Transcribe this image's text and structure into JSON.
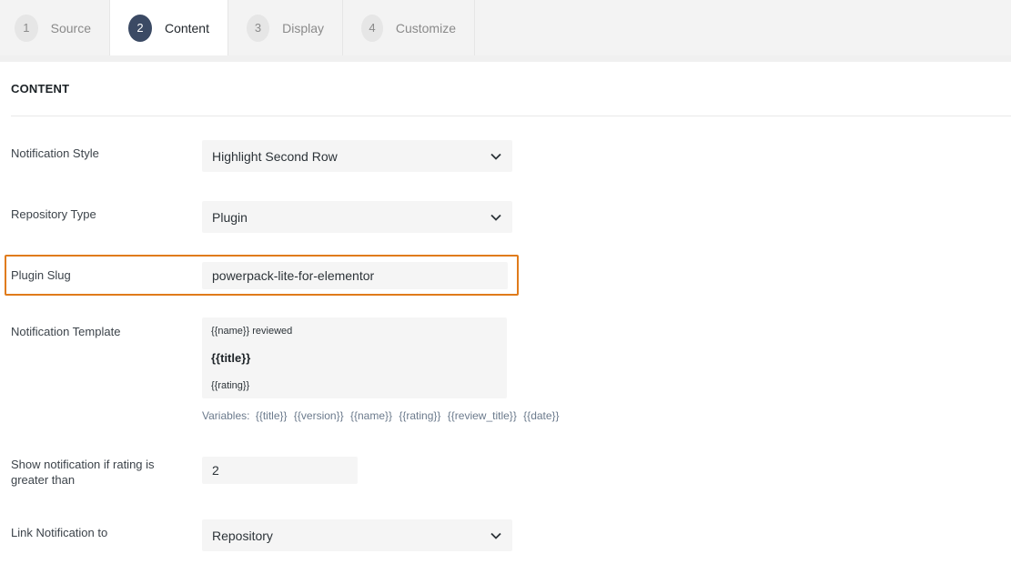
{
  "steps": [
    {
      "number": "1",
      "label": "Source"
    },
    {
      "number": "2",
      "label": "Content"
    },
    {
      "number": "3",
      "label": "Display"
    },
    {
      "number": "4",
      "label": "Customize"
    }
  ],
  "active_step": "Content",
  "section": {
    "title": "CONTENT"
  },
  "fields": {
    "notification_style": {
      "label": "Notification Style",
      "value": "Highlight Second Row"
    },
    "repository_type": {
      "label": "Repository Type",
      "value": "Plugin"
    },
    "plugin_slug": {
      "label": "Plugin Slug",
      "value": "powerpack-lite-for-elementor"
    },
    "notification_template": {
      "label": "Notification Template",
      "line1": "{{name}} reviewed",
      "line2": "{{title}}",
      "line3": "{{rating}}",
      "variables_label": "Variables:",
      "variables": [
        "{{title}}",
        "{{version}}",
        "{{name}}",
        "{{rating}}",
        "{{review_title}}",
        "{{date}}"
      ]
    },
    "rating_threshold": {
      "label_line1": "Show notification if rating is",
      "label_line2": "greater than",
      "value": "2"
    },
    "link_notification": {
      "label": "Link Notification to",
      "value": "Repository"
    }
  },
  "colors": {
    "highlight_border": "#e07b1a",
    "active_step_badge": "#3b4a64"
  },
  "icons": {
    "select_arrow": "chevron-down-icon"
  }
}
